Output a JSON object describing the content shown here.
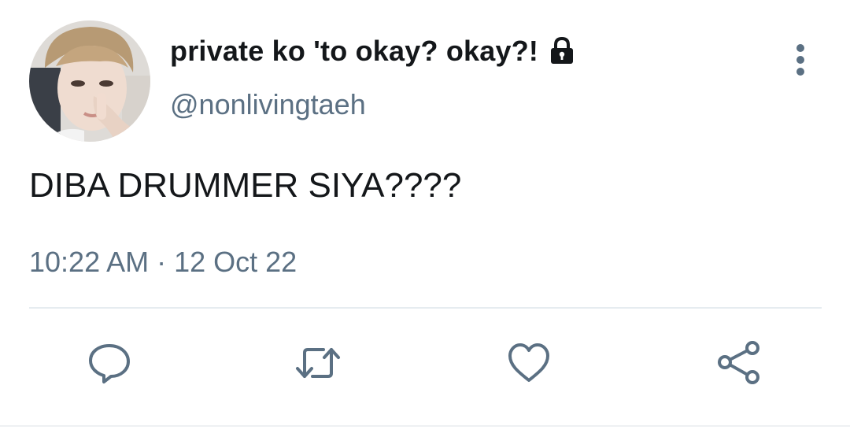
{
  "tweet": {
    "display_name": "private ko 'to okay? okay?!",
    "handle": "@nonlivingtaeh",
    "text": "DIBA DRUMMER SIYA????",
    "timestamp": "10:22 AM · 12 Oct 22",
    "protected": true
  },
  "icons": {
    "lock": "lock-icon",
    "more": "more-vertical-icon",
    "reply": "reply-icon",
    "retweet": "retweet-icon",
    "like": "heart-icon",
    "share": "share-icon"
  },
  "colors": {
    "text_primary": "#14171a",
    "text_secondary": "#5b7083",
    "divider": "#e6ecf0",
    "icon": "#5b7083"
  }
}
